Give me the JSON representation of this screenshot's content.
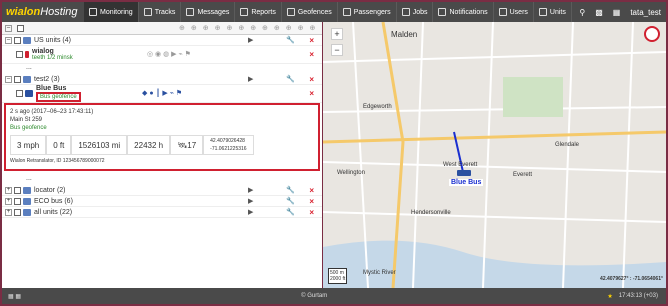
{
  "brand": {
    "logo_left": "wialon",
    "logo_right": "Hosting"
  },
  "nav": [
    "Monitoring",
    "Tracks",
    "Messages",
    "Reports",
    "Geofences",
    "Passengers",
    "Jobs",
    "Notifications",
    "Users",
    "Units"
  ],
  "user": "tata_test",
  "groups": [
    {
      "title": "US units (4)",
      "units": [
        {
          "name": "wialog",
          "status": "teeth",
          "extra": "1/2 minsk"
        }
      ]
    },
    {
      "title": "test2 (3)",
      "units": [
        {
          "name": "Blue Bus",
          "status": "Bus geofence"
        }
      ]
    },
    {
      "title": "locator (2)"
    },
    {
      "title": "ECO bus (6)"
    },
    {
      "title": "all units (22)"
    }
  ],
  "detail": {
    "time": "2 s ago (2017–06–23 17:43:11)",
    "address": "Main St 259",
    "geofence": "Bus geofence",
    "speed": "3 mph",
    "alt": "0 ft",
    "mileage": "1526103 mi",
    "hours": "22432 h",
    "sats": "17",
    "lat": "42.4079026428",
    "lon": "-71.0621225316",
    "device": "Wialon Retranslator, ID 123456789000072"
  },
  "dots": "...",
  "map": {
    "labels": [
      "Malden",
      "Edgeworth",
      "Wellington",
      "West Everett",
      "Everett",
      "Glendale",
      "Hendersonville",
      "Mystic River"
    ],
    "bus_label": "Blue Bus",
    "scale_km": "500 m",
    "scale_ft": "2000 ft",
    "coords": "42.4079627° : -71.0654061°"
  },
  "status": {
    "center": "© Gurtam",
    "time": "17:43:13 (+03)"
  },
  "colors": {
    "accent": "#d02030",
    "topbar": "#4a4a4a"
  }
}
